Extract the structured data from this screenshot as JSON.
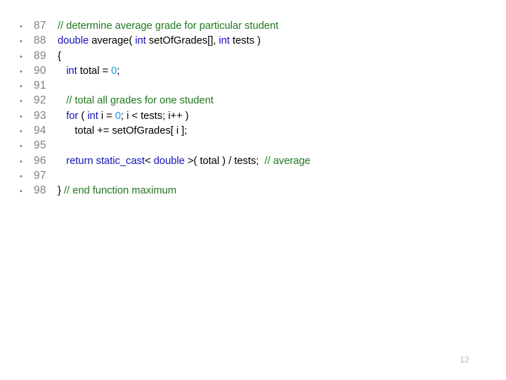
{
  "slide": {
    "background_color": "#ffffff",
    "slide_number": "12",
    "bullet_glyph": "•",
    "colors": {
      "keyword": "#1111BB",
      "comment": "#217821",
      "number_literal": "#1A9BD7",
      "plain": "#000000",
      "line_number": "#808080",
      "slide_number": "#b8b8b8"
    }
  },
  "code": {
    "language": "C++",
    "lines": [
      {
        "number": "87",
        "text": "// determine average grade for particular student",
        "tokens": [
          {
            "t": "// determine average grade for particular student",
            "k": "comment"
          }
        ]
      },
      {
        "number": "88",
        "text": "double average( int setOfGrades[], int tests )",
        "tokens": [
          {
            "t": "double",
            "k": "keyword"
          },
          {
            "t": " average( ",
            "k": "plain"
          },
          {
            "t": "int",
            "k": "keyword"
          },
          {
            "t": " setOfGrades[], ",
            "k": "plain"
          },
          {
            "t": "int",
            "k": "keyword"
          },
          {
            "t": " tests )",
            "k": "plain"
          }
        ]
      },
      {
        "number": "89",
        "text": "{",
        "tokens": [
          {
            "t": "{",
            "k": "plain"
          }
        ]
      },
      {
        "number": "90",
        "text": "   int total = 0;",
        "tokens": [
          {
            "t": "   ",
            "k": "plain"
          },
          {
            "t": "int",
            "k": "keyword"
          },
          {
            "t": " total = ",
            "k": "plain"
          },
          {
            "t": "0",
            "k": "number"
          },
          {
            "t": ";",
            "k": "plain"
          }
        ]
      },
      {
        "number": "91",
        "text": "",
        "tokens": []
      },
      {
        "number": "92",
        "text": "   // total all grades for one student",
        "tokens": [
          {
            "t": "   ",
            "k": "plain"
          },
          {
            "t": "// total all grades for one student",
            "k": "comment"
          }
        ]
      },
      {
        "number": "93",
        "text": "   for ( int i = 0; i < tests; i++ )",
        "tokens": [
          {
            "t": "   ",
            "k": "plain"
          },
          {
            "t": "for",
            "k": "keyword"
          },
          {
            "t": " ( ",
            "k": "plain"
          },
          {
            "t": "int",
            "k": "keyword"
          },
          {
            "t": " i = ",
            "k": "plain"
          },
          {
            "t": "0",
            "k": "number"
          },
          {
            "t": "; i < tests; i++ )",
            "k": "plain"
          }
        ]
      },
      {
        "number": "94",
        "text": "      total += setOfGrades[ i ];",
        "tokens": [
          {
            "t": "      total += setOfGrades[ i ];",
            "k": "plain"
          }
        ]
      },
      {
        "number": "95",
        "text": "",
        "tokens": []
      },
      {
        "number": "96",
        "text": "   return static_cast< double >( total ) / tests;  // average",
        "tokens": [
          {
            "t": "   ",
            "k": "plain"
          },
          {
            "t": "return static_cast",
            "k": "keyword"
          },
          {
            "t": "< ",
            "k": "plain"
          },
          {
            "t": "double",
            "k": "keyword"
          },
          {
            "t": " >( total ) / tests;  ",
            "k": "plain"
          },
          {
            "t": "// average",
            "k": "comment"
          }
        ]
      },
      {
        "number": "97",
        "text": "",
        "tokens": []
      },
      {
        "number": "98",
        "text": "} // end function maximum",
        "tokens": [
          {
            "t": "} ",
            "k": "plain"
          },
          {
            "t": "// end function maximum",
            "k": "comment"
          }
        ]
      }
    ]
  }
}
